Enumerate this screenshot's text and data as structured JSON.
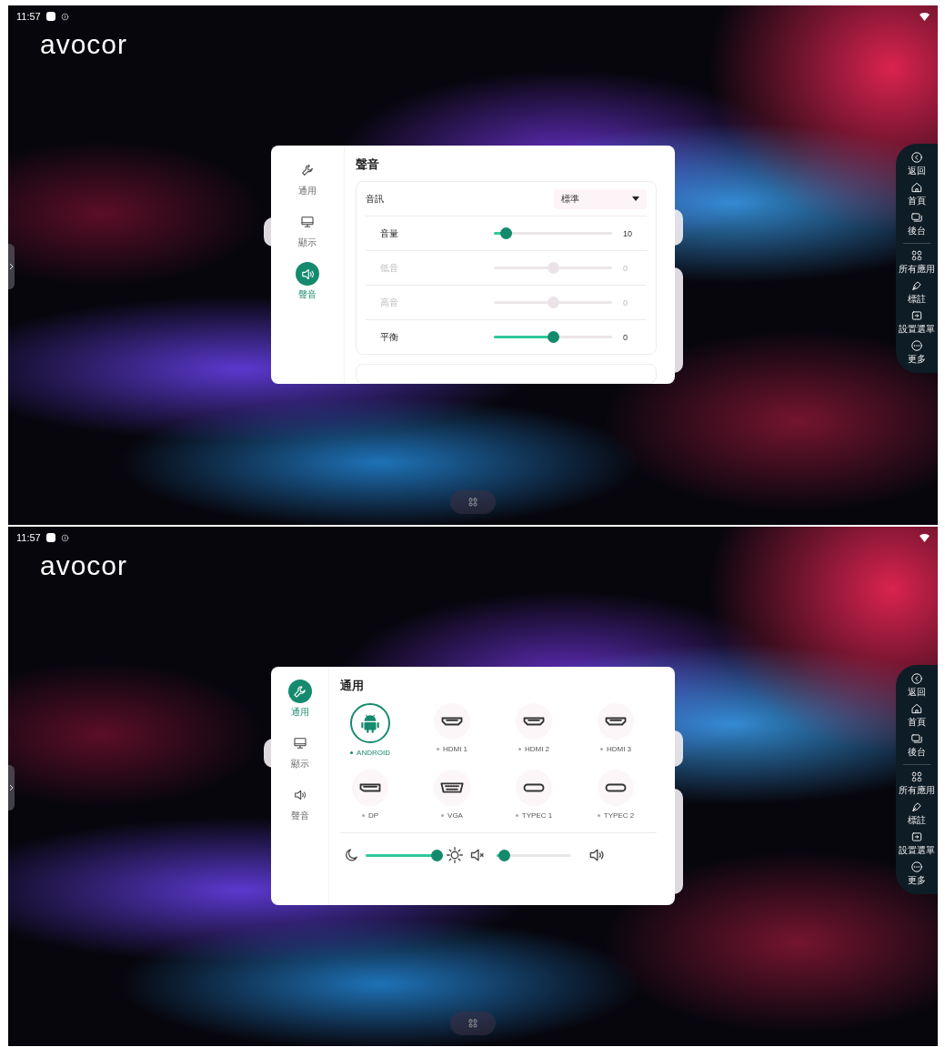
{
  "screens": [
    {
      "status_bar": {
        "time": "11:57"
      },
      "logo": "avocor",
      "dialog": {
        "kind": "sound",
        "title": "聲音",
        "nav": [
          {
            "label": "通用",
            "kind": "wrench",
            "selected": false
          },
          {
            "label": "顯示",
            "kind": "monitor",
            "selected": false
          },
          {
            "label": "聲音",
            "kind": "speaker",
            "selected": true
          }
        ],
        "mode": {
          "label": "音訊",
          "value": "標準"
        },
        "sliders": [
          {
            "label": "音量",
            "level": 0.1,
            "reading": "10",
            "disabled": false
          },
          {
            "label": "低音",
            "level": 0.5,
            "reading": "0",
            "disabled": true
          },
          {
            "label": "高音",
            "level": 0.5,
            "reading": "0",
            "disabled": true
          },
          {
            "label": "平衡",
            "level": 0.5,
            "reading": "0",
            "disabled": false
          }
        ]
      },
      "dock": [
        {
          "label": "返回",
          "kind": "back"
        },
        {
          "label": "首頁",
          "kind": "home"
        },
        {
          "label": "後台",
          "kind": "windows"
        },
        {
          "label": "所有應用",
          "kind": "apps"
        },
        {
          "label": "標註",
          "kind": "pen"
        },
        {
          "label": "設置選單",
          "kind": "input"
        },
        {
          "label": "更多",
          "kind": "more"
        }
      ]
    },
    {
      "status_bar": {
        "time": "11:57"
      },
      "logo": "avocor",
      "dialog": {
        "kind": "general",
        "title": "通用",
        "nav": [
          {
            "label": "通用",
            "kind": "wrench",
            "selected": true
          },
          {
            "label": "顯示",
            "kind": "monitor",
            "selected": false
          },
          {
            "label": "聲音",
            "kind": "speaker",
            "selected": false
          }
        ],
        "sources": [
          {
            "label": "ANDROID",
            "kind": "android",
            "selected": true
          },
          {
            "label": "HDMI 1",
            "kind": "hdmi",
            "selected": false
          },
          {
            "label": "HDMI 2",
            "kind": "hdmi",
            "selected": false
          },
          {
            "label": "HDMI 3",
            "kind": "hdmi",
            "selected": false
          },
          {
            "label": "DP",
            "kind": "dp",
            "selected": false
          },
          {
            "label": "VGA",
            "kind": "vga",
            "selected": false
          },
          {
            "label": "TYPEC 1",
            "kind": "typec",
            "selected": false
          },
          {
            "label": "TYPEC 2",
            "kind": "typec",
            "selected": false
          }
        ],
        "brightness": {
          "level": 0.95
        },
        "volume": {
          "level": 0.1
        }
      },
      "dock": [
        {
          "label": "返回",
          "kind": "back"
        },
        {
          "label": "首頁",
          "kind": "home"
        },
        {
          "label": "後台",
          "kind": "windows"
        },
        {
          "label": "所有應用",
          "kind": "apps"
        },
        {
          "label": "標註",
          "kind": "pen"
        },
        {
          "label": "設置選單",
          "kind": "input"
        },
        {
          "label": "更多",
          "kind": "more"
        }
      ]
    }
  ]
}
